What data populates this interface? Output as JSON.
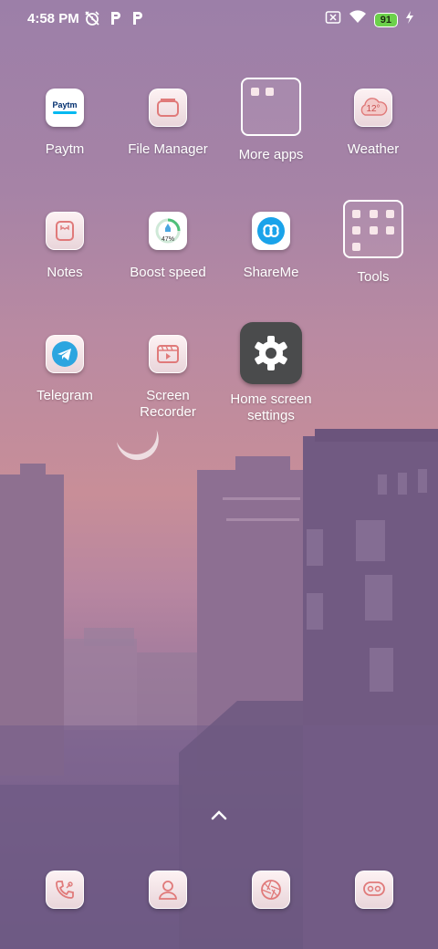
{
  "status": {
    "time": "4:58 PM",
    "battery": "91",
    "left_icons": [
      "alarm-off-icon",
      "paytm-notification-icon",
      "paytm-notification-icon"
    ],
    "right_icons": [
      "no-sim-icon",
      "wifi-icon",
      "battery-icon",
      "charging-icon"
    ]
  },
  "apps": {
    "paytm": {
      "label": "Paytm",
      "icon_text": "Paytm"
    },
    "file_manager": {
      "label": "File Manager"
    },
    "more_apps": {
      "label": "More apps"
    },
    "weather": {
      "label": "Weather",
      "icon_text": "12°"
    },
    "notes": {
      "label": "Notes"
    },
    "boost_speed": {
      "label": "Boost speed",
      "icon_text": "47%"
    },
    "shareme": {
      "label": "ShareMe"
    },
    "tools": {
      "label": "Tools"
    },
    "telegram": {
      "label": "Telegram"
    },
    "screen_recorder": {
      "label_line1": "Screen",
      "label_line2": "Recorder"
    },
    "home_screen_settings": {
      "label_line1": "Home screen",
      "label_line2": "settings"
    }
  },
  "dock": [
    "phone-icon",
    "contacts-icon",
    "camera-icon",
    "messaging-icon"
  ],
  "colors": {
    "accent_icon": "#e07a7a",
    "battery": "#6cd14b",
    "settings_bg": "#4a4b4c"
  }
}
